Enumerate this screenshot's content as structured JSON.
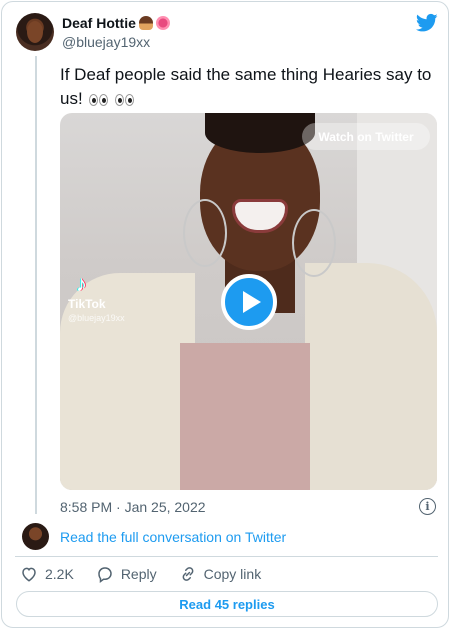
{
  "author": {
    "name": "Deaf Hottie",
    "handle": "@bluejay19xx",
    "name_emojis": [
      "deaf-person-emoji",
      "ear-emoji"
    ]
  },
  "tweet": {
    "text": "If Deaf people said the same thing Hearies say to us!",
    "trailing_emojis": [
      "eyes-emoji",
      "eyes-emoji"
    ],
    "timestamp": "8:58 PM · Jan 25, 2022"
  },
  "media": {
    "watch_label": "Watch on Twitter",
    "watermark_brand": "TikTok",
    "watermark_user": "@bluejay19xx"
  },
  "conversation_link": "Read the full conversation on Twitter",
  "actions": {
    "like_count": "2.2K",
    "reply_label": "Reply",
    "copy_label": "Copy link"
  },
  "read_replies_label": "Read 45 replies",
  "colors": {
    "accent": "#1d9bf0",
    "text": "#0f1419",
    "muted": "#536471",
    "border": "#cfd9de"
  }
}
